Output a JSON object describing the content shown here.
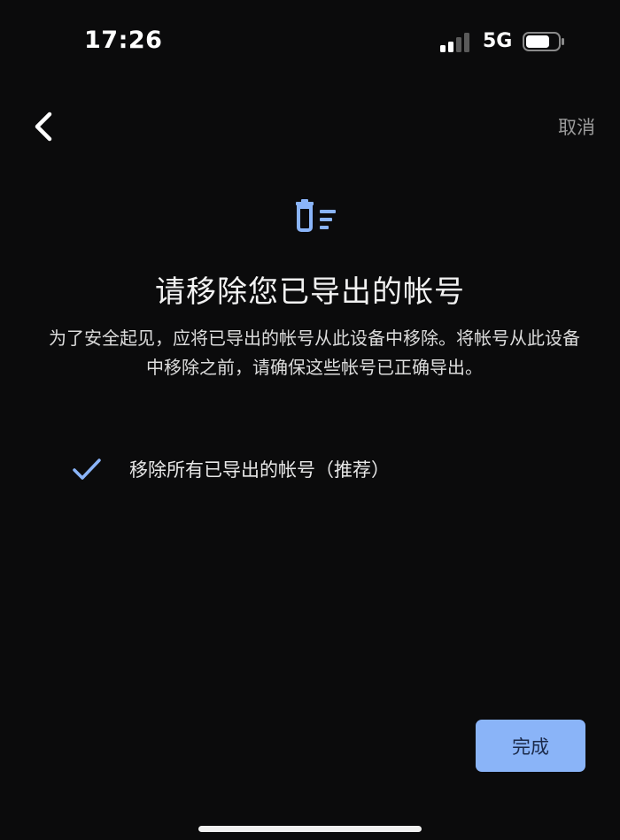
{
  "status_bar": {
    "time": "17:26",
    "network": "5G"
  },
  "nav": {
    "cancel_label": "取消"
  },
  "content": {
    "title": "请移除您已导出的帐号",
    "description": "为了安全起见，应将已导出的帐号从此设备中移除。将帐号从此设备中移除之前，请确保这些帐号已正确导出。",
    "option_label": "移除所有已导出的帐号（推荐）",
    "option_checked": true
  },
  "footer": {
    "done_label": "完成"
  },
  "colors": {
    "background": "#0b0b0c",
    "accent": "#8ab4f8",
    "muted_text": "#9a9a9a"
  },
  "icons": {
    "back": "chevron-left-icon",
    "header": "delete-list-icon",
    "check": "check-icon"
  }
}
